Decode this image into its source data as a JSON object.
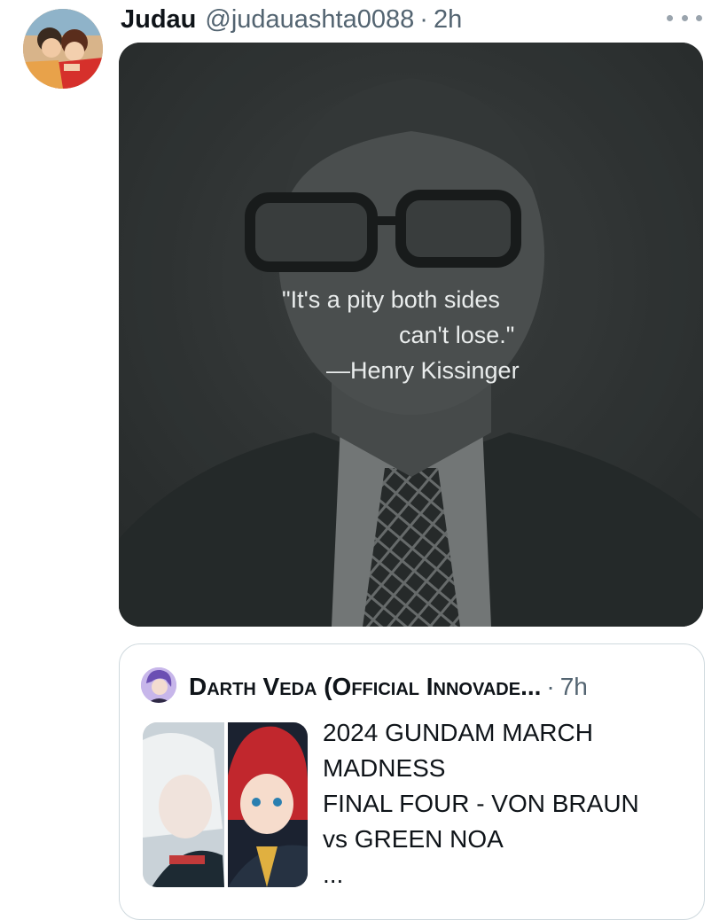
{
  "tweet": {
    "author_name": "Judau",
    "handle": "@judauashta0088",
    "separator": "·",
    "time": "2h",
    "media": {
      "quote_line1": "\"It's a pity both sides",
      "quote_line2": "can't lose.\"",
      "attribution": "—Henry Kissinger"
    }
  },
  "quoted_tweet": {
    "author_name": "Darth Veda (Official Innovade...",
    "separator": "·",
    "time": "7h",
    "text_lines": [
      "2024 GUNDAM MARCH",
      "MADNESS",
      "FINAL FOUR - VON BRAUN",
      "vs GREEN NOA",
      "..."
    ]
  }
}
